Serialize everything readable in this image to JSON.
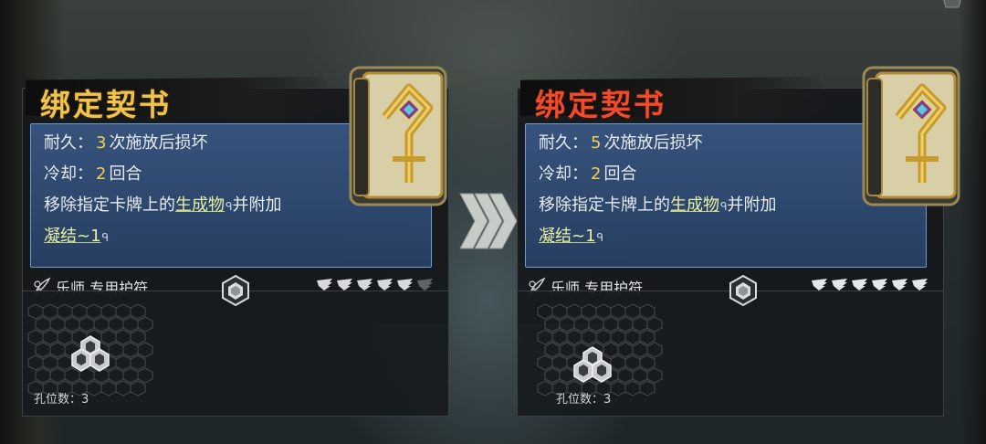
{
  "colors": {
    "title_before": "#f1c34a",
    "title_after": "#f04b2a",
    "number": "#f3cf4e",
    "keyword": "#e6f0a6",
    "desc_bg": "#38567f"
  },
  "upgrade_arrow_icon": "triple-chevron-right-icon",
  "cards": {
    "before": {
      "title": "绑定契书",
      "durability_label": "耐久：",
      "durability_value": "3",
      "durability_suffix": "次施放后损坏",
      "cooldown_label": "冷却：",
      "cooldown_value": "2",
      "cooldown_suffix": "回合",
      "effect_prefix": "移除指定卡牌上的",
      "effect_keyword": "生成物",
      "effect_mid": "并附加",
      "effect_keyword2": "凝结~1",
      "class_text": "乐师 专用护符",
      "stars_filled": 5,
      "stars_total": 6,
      "socket_count_text": "孔位数：3",
      "icon": "binding-book-icon"
    },
    "after": {
      "title": "绑定契书",
      "durability_label": "耐久：",
      "durability_value": "5",
      "durability_suffix": "次施放后损坏",
      "cooldown_label": "冷却：",
      "cooldown_value": "2",
      "cooldown_suffix": "回合",
      "effect_prefix": "移除指定卡牌上的",
      "effect_keyword": "生成物",
      "effect_mid": "并附加",
      "effect_keyword2": "凝结~1",
      "class_text": "乐师 专用护符",
      "stars_filled": 6,
      "stars_total": 6,
      "socket_count_text": "孔位数：3",
      "icon": "binding-book-icon"
    }
  }
}
